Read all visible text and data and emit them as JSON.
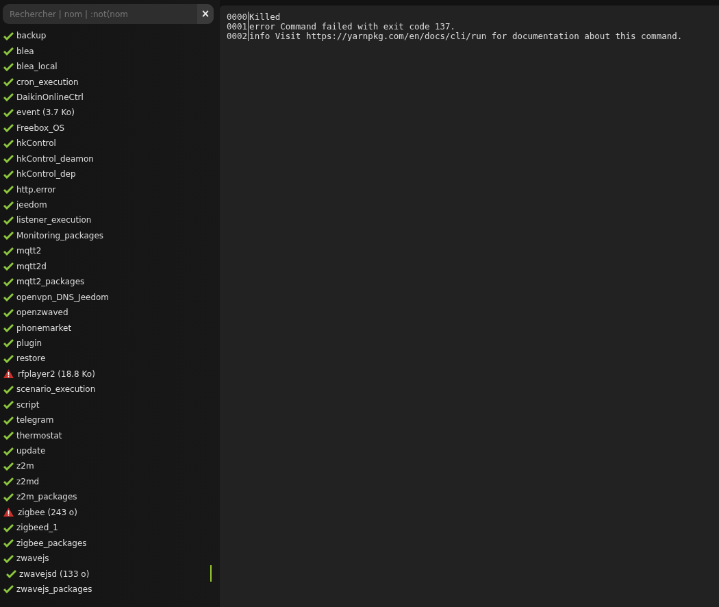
{
  "search": {
    "placeholder": "Rechercher | nom | :not(nom",
    "clear": "×"
  },
  "logs": [
    {
      "name": "backup",
      "kind": "ok",
      "selected": false
    },
    {
      "name": "blea",
      "kind": "ok",
      "selected": false
    },
    {
      "name": "blea_local",
      "kind": "ok",
      "selected": false
    },
    {
      "name": "cron_execution",
      "kind": "ok",
      "selected": false
    },
    {
      "name": "DaikinOnlineCtrl",
      "kind": "ok",
      "selected": false
    },
    {
      "name": "event (3.7 Ko)",
      "kind": "ok",
      "selected": false
    },
    {
      "name": "Freebox_OS",
      "kind": "ok",
      "selected": false
    },
    {
      "name": "hkControl",
      "kind": "ok",
      "selected": false
    },
    {
      "name": "hkControl_deamon",
      "kind": "ok",
      "selected": false
    },
    {
      "name": "hkControl_dep",
      "kind": "ok",
      "selected": false
    },
    {
      "name": "http.error",
      "kind": "ok",
      "selected": false
    },
    {
      "name": "jeedom",
      "kind": "ok",
      "selected": false
    },
    {
      "name": "listener_execution",
      "kind": "ok",
      "selected": false
    },
    {
      "name": "Monitoring_packages",
      "kind": "ok",
      "selected": false
    },
    {
      "name": "mqtt2",
      "kind": "ok",
      "selected": false
    },
    {
      "name": "mqtt2d",
      "kind": "ok",
      "selected": false
    },
    {
      "name": "mqtt2_packages",
      "kind": "ok",
      "selected": false
    },
    {
      "name": "openvpn_DNS_Jeedom",
      "kind": "ok",
      "selected": false
    },
    {
      "name": "openzwaved",
      "kind": "ok",
      "selected": false
    },
    {
      "name": "phonemarket",
      "kind": "ok",
      "selected": false
    },
    {
      "name": "plugin",
      "kind": "ok",
      "selected": false
    },
    {
      "name": "restore",
      "kind": "ok",
      "selected": false
    },
    {
      "name": "rfplayer2 (18.8 Ko)",
      "kind": "warning",
      "selected": false
    },
    {
      "name": "scenario_execution",
      "kind": "ok",
      "selected": false
    },
    {
      "name": "script",
      "kind": "ok",
      "selected": false
    },
    {
      "name": "telegram",
      "kind": "ok",
      "selected": false
    },
    {
      "name": "thermostat",
      "kind": "ok",
      "selected": false
    },
    {
      "name": "update",
      "kind": "ok",
      "selected": false
    },
    {
      "name": "z2m",
      "kind": "ok",
      "selected": false
    },
    {
      "name": "z2md",
      "kind": "ok",
      "selected": false
    },
    {
      "name": "z2m_packages",
      "kind": "ok",
      "selected": false
    },
    {
      "name": "zigbee (243 o)",
      "kind": "warning",
      "selected": false
    },
    {
      "name": "zigbeed_1",
      "kind": "ok",
      "selected": false
    },
    {
      "name": "zigbee_packages",
      "kind": "ok",
      "selected": false
    },
    {
      "name": "zwavejs",
      "kind": "ok",
      "selected": false
    },
    {
      "name": "zwavejsd (133 o)",
      "kind": "ok",
      "selected": true
    },
    {
      "name": "zwavejs_packages",
      "kind": "ok",
      "selected": false
    }
  ],
  "console": [
    {
      "number": "0000",
      "text": "Killed"
    },
    {
      "number": "0001",
      "text": "error Command failed with exit code 137."
    },
    {
      "number": "0002",
      "text": "info Visit https://yarnpkg.com/en/docs/cli/run for documentation about this command."
    }
  ]
}
